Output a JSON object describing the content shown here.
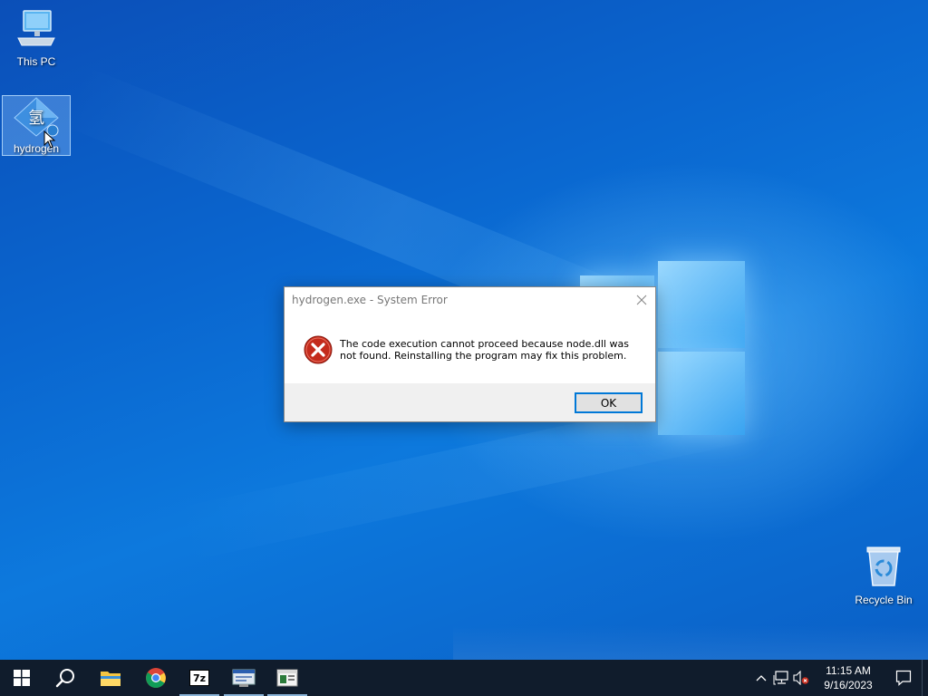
{
  "desktop": {
    "icons": {
      "this_pc": "This PC",
      "hydrogen": "hydrogen",
      "recycle_bin": "Recycle Bin"
    },
    "hydrogen_icon_glyph": "氢"
  },
  "dialog": {
    "title": "hydrogen.exe - System Error",
    "message": "The code execution cannot proceed because node.dll was not found. Reinstalling the program may fix this problem.",
    "ok_label": "OK",
    "icon": "error-icon"
  },
  "taskbar": {
    "apps": [
      "start-icon",
      "search-icon",
      "file-explorer-icon",
      "chrome-icon",
      "7zip-icon",
      "app-icon",
      "app-icon"
    ],
    "seven_zip_text": "7z",
    "clock": {
      "time": "11:15 AM",
      "date": "9/16/2023"
    }
  },
  "colors": {
    "desktop_blue": "#0a66cf",
    "taskbar": "#101c2c",
    "error_red": "#c42b1c",
    "accent": "#0078d7"
  }
}
